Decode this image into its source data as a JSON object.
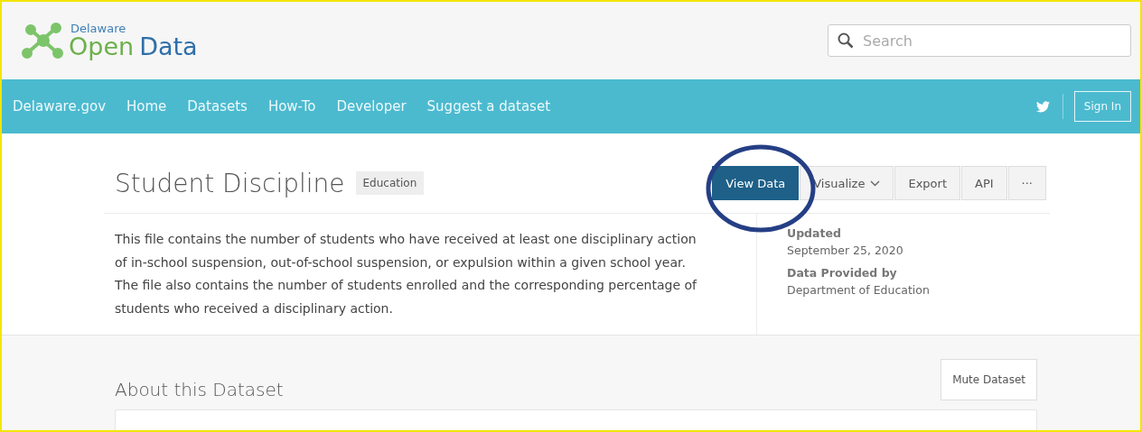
{
  "header": {
    "logo": {
      "line_1": "Delaware",
      "word_1": "Open",
      "word_2": "Data"
    },
    "search": {
      "placeholder": "Search"
    }
  },
  "nav": {
    "items": [
      "Delaware.gov",
      "Home",
      "Datasets",
      "How-To",
      "Developer",
      "Suggest a dataset"
    ],
    "sign_in": "Sign In"
  },
  "dataset": {
    "title": "Student Discipline",
    "category": "Education",
    "actions": [
      {
        "label": "View Data",
        "kind": "primary"
      },
      {
        "label": "Visualize",
        "kind": "dropdown"
      },
      {
        "label": "Export",
        "kind": "plain"
      },
      {
        "label": "API",
        "kind": "plain"
      },
      {
        "label": "···",
        "kind": "more"
      }
    ],
    "description": "This file contains the number of students who have received at least one disciplinary action of in-school suspension, out-of-school suspension, or expulsion within a given school year. The file also contains the number of students enrolled and the corresponding percentage of students who received a disciplinary action.",
    "meta": [
      {
        "label": "Updated",
        "value": "September 25, 2020"
      },
      {
        "label": "Data Provided by",
        "value": "Department of Education"
      }
    ]
  },
  "about": {
    "title": "About this Dataset",
    "mute_button": "Mute Dataset"
  }
}
